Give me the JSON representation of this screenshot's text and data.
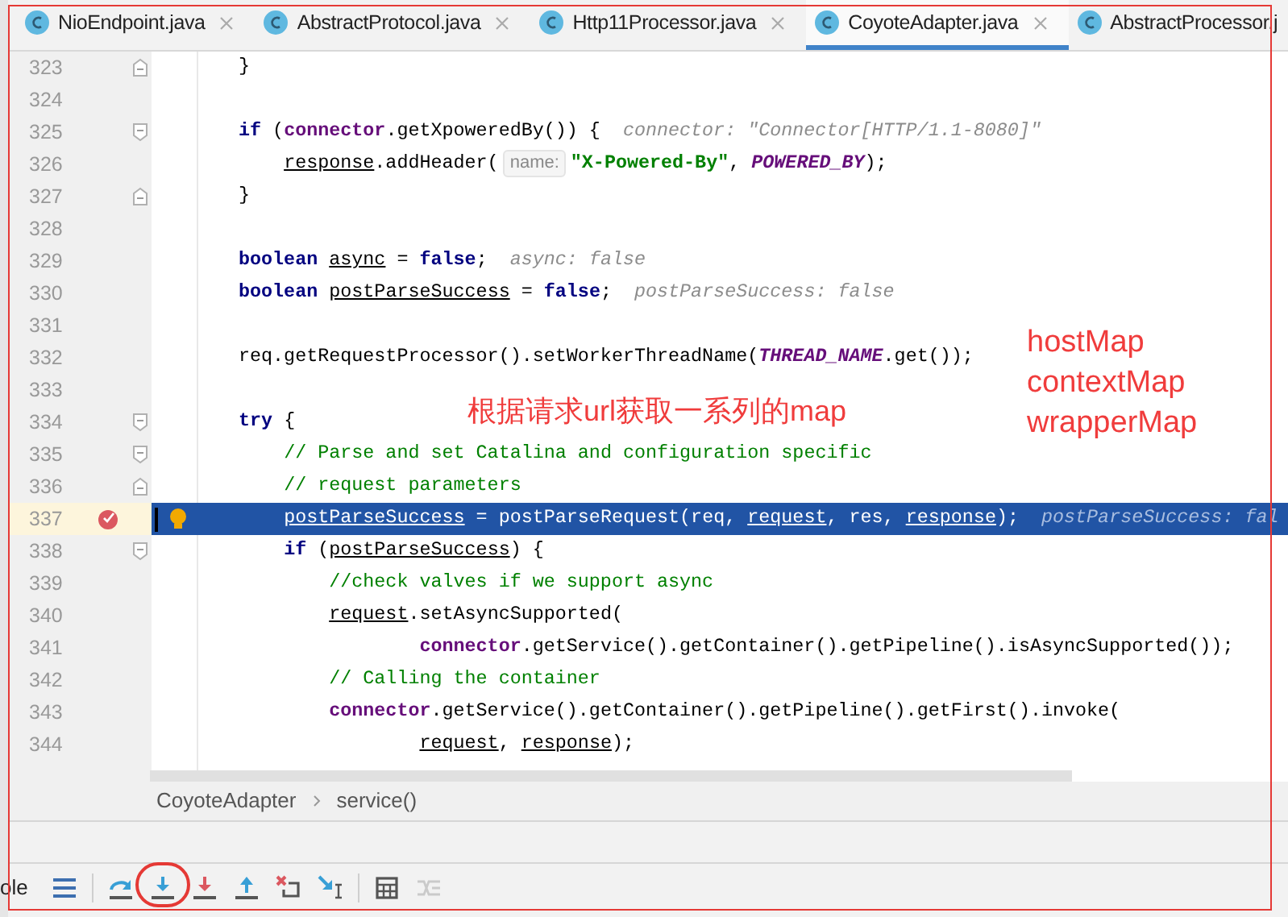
{
  "tabs": [
    {
      "label": "NioEndpoint.java",
      "selected": false,
      "closable": true
    },
    {
      "label": "AbstractProtocol.java",
      "selected": false,
      "closable": true
    },
    {
      "label": "Http11Processor.java",
      "selected": false,
      "closable": true
    },
    {
      "label": "CoyoteAdapter.java",
      "selected": true,
      "closable": true
    },
    {
      "label": "AbstractProcessor.j",
      "selected": false,
      "closable": false
    }
  ],
  "editor": {
    "lines": [
      {
        "number": "323",
        "selected": false,
        "breakpoint": false,
        "fold_start": false,
        "fold_end": true,
        "segments": [
          {
            "kind": "plain",
            "text": "}"
          }
        ]
      },
      {
        "number": "324",
        "selected": false,
        "breakpoint": false,
        "fold_start": false,
        "fold_end": false
      },
      {
        "number": "325",
        "selected": false,
        "breakpoint": false,
        "fold_start": true,
        "fold_end": false,
        "segments": [
          {
            "kind": "keyword",
            "text": "if"
          },
          {
            "kind": "plain",
            "text": " ("
          },
          {
            "kind": "field",
            "text": "connector"
          },
          {
            "kind": "plain",
            "text": ".getXpoweredBy()) {"
          },
          {
            "kind": "hint",
            "text": "connector: \"Connector[HTTP/1.1-8080]\""
          }
        ]
      },
      {
        "number": "326",
        "selected": false,
        "breakpoint": false,
        "fold_start": false,
        "fold_end": false,
        "segments": [
          {
            "kind": "variable",
            "text": "    response"
          },
          {
            "kind": "plain",
            "text": ".addHeader("
          },
          {
            "kind": "param",
            "text": "name:"
          },
          {
            "kind": "string",
            "text": "\"X-Powered-By\""
          },
          {
            "kind": "plain",
            "text": ", "
          },
          {
            "kind": "constant",
            "text": "POWERED_BY"
          },
          {
            "kind": "plain",
            "text": ");"
          }
        ]
      },
      {
        "number": "327",
        "selected": false,
        "breakpoint": false,
        "fold_start": false,
        "fold_end": true,
        "segments": [
          {
            "kind": "plain",
            "text": "}"
          }
        ]
      },
      {
        "number": "328",
        "selected": false,
        "breakpoint": false,
        "fold_start": false,
        "fold_end": false
      },
      {
        "number": "329",
        "selected": false,
        "breakpoint": false,
        "fold_start": false,
        "fold_end": false,
        "segments": [
          {
            "kind": "keyword",
            "text": "boolean"
          },
          {
            "kind": "variable",
            "text": " async"
          },
          {
            "kind": "plain",
            "text": " = "
          },
          {
            "kind": "keyword",
            "text": "false"
          },
          {
            "kind": "plain",
            "text": ";"
          },
          {
            "kind": "hint",
            "text": "async: false"
          }
        ]
      },
      {
        "number": "330",
        "selected": false,
        "breakpoint": false,
        "fold_start": false,
        "fold_end": false,
        "segments": [
          {
            "kind": "keyword",
            "text": "boolean"
          },
          {
            "kind": "variable",
            "text": " postParseSuccess"
          },
          {
            "kind": "plain",
            "text": " = "
          },
          {
            "kind": "keyword",
            "text": "false"
          },
          {
            "kind": "plain",
            "text": ";"
          },
          {
            "kind": "hint",
            "text": "postParseSuccess: false"
          }
        ]
      },
      {
        "number": "331",
        "selected": false,
        "breakpoint": false,
        "fold_start": false,
        "fold_end": false
      },
      {
        "number": "332",
        "selected": false,
        "breakpoint": false,
        "fold_start": false,
        "fold_end": false,
        "segments": [
          {
            "kind": "plain",
            "text": "req.getRequestProcessor().setWorkerThreadName("
          },
          {
            "kind": "constant",
            "text": "THREAD_NAME"
          },
          {
            "kind": "plain",
            "text": ".get());"
          }
        ]
      },
      {
        "number": "333",
        "selected": false,
        "breakpoint": false,
        "fold_start": false,
        "fold_end": false
      },
      {
        "number": "334",
        "selected": false,
        "breakpoint": false,
        "fold_start": true,
        "fold_end": false,
        "segments": [
          {
            "kind": "keyword",
            "text": "try"
          },
          {
            "kind": "plain",
            "text": " {"
          }
        ]
      },
      {
        "number": "335",
        "selected": false,
        "breakpoint": false,
        "fold_start": true,
        "fold_end": false,
        "segments": [
          {
            "kind": "comment",
            "text": "    // Parse and set Catalina and configuration specific"
          }
        ]
      },
      {
        "number": "336",
        "selected": false,
        "breakpoint": false,
        "fold_start": false,
        "fold_end": true,
        "segments": [
          {
            "kind": "comment",
            "text": "    // request parameters"
          }
        ]
      },
      {
        "number": "337",
        "selected": true,
        "breakpoint": true,
        "fold_start": false,
        "fold_end": false,
        "segments": [
          {
            "kind": "variable",
            "text": "    postParseSuccess"
          },
          {
            "kind": "plain",
            "text": " = postParseRequest(req, "
          },
          {
            "kind": "variable",
            "text": "request"
          },
          {
            "kind": "plain",
            "text": ", res, "
          },
          {
            "kind": "variable",
            "text": "response"
          },
          {
            "kind": "plain",
            "text": ");"
          },
          {
            "kind": "hint",
            "text": "postParseSuccess: fal"
          }
        ]
      },
      {
        "number": "338",
        "selected": false,
        "breakpoint": false,
        "fold_start": true,
        "fold_end": false,
        "segments": [
          {
            "kind": "keyword",
            "text": "    if"
          },
          {
            "kind": "plain",
            "text": " ("
          },
          {
            "kind": "variable",
            "text": "postParseSuccess"
          },
          {
            "kind": "plain",
            "text": ") {"
          }
        ]
      },
      {
        "number": "339",
        "selected": false,
        "breakpoint": false,
        "fold_start": false,
        "fold_end": false,
        "segments": [
          {
            "kind": "comment",
            "text": "        //check valves if we support async"
          }
        ]
      },
      {
        "number": "340",
        "selected": false,
        "breakpoint": false,
        "fold_start": false,
        "fold_end": false,
        "segments": [
          {
            "kind": "variable",
            "text": "        request"
          },
          {
            "kind": "plain",
            "text": ".setAsyncSupported("
          }
        ]
      },
      {
        "number": "341",
        "selected": false,
        "breakpoint": false,
        "fold_start": false,
        "fold_end": false,
        "segments": [
          {
            "kind": "field",
            "text": "                connector"
          },
          {
            "kind": "plain",
            "text": ".getService().getContainer().getPipeline().isAsyncSupported());"
          }
        ]
      },
      {
        "number": "342",
        "selected": false,
        "breakpoint": false,
        "fold_start": false,
        "fold_end": false,
        "segments": [
          {
            "kind": "comment",
            "text": "        // Calling the container"
          }
        ]
      },
      {
        "number": "343",
        "selected": false,
        "breakpoint": false,
        "fold_start": false,
        "fold_end": false,
        "segments": [
          {
            "kind": "field",
            "text": "        connector"
          },
          {
            "kind": "plain",
            "text": ".getService().getContainer().getPipeline().getFirst().invoke("
          }
        ]
      },
      {
        "number": "344",
        "selected": false,
        "breakpoint": false,
        "fold_start": false,
        "fold_end": false,
        "segments": [
          {
            "kind": "variable",
            "text": "                request"
          },
          {
            "kind": "plain",
            "text": ", "
          },
          {
            "kind": "variable",
            "text": "response"
          },
          {
            "kind": "plain",
            "text": ");"
          }
        ]
      }
    ]
  },
  "annotations": {
    "note": "根据请求url获取一系列的map",
    "maps": [
      "hostMap",
      "contextMap",
      "wrapperMap"
    ]
  },
  "breadcrumbs": [
    "CoyoteAdapter",
    "service()"
  ],
  "debug_toolbar": {
    "label": "ole",
    "buttons": [
      {
        "kind": "lines",
        "disabled": false,
        "circled": false
      },
      {
        "kind": "step-over",
        "disabled": false,
        "circled": false
      },
      {
        "kind": "step-into",
        "disabled": false,
        "circled": true
      },
      {
        "kind": "force-step-into",
        "disabled": false,
        "circled": false
      },
      {
        "kind": "step-out",
        "disabled": false,
        "circled": false
      },
      {
        "kind": "drop-frame",
        "disabled": false,
        "circled": false
      },
      {
        "kind": "run-to-cursor",
        "disabled": false,
        "circled": false
      },
      {
        "kind": "evaluate",
        "disabled": false,
        "circled": false
      },
      {
        "kind": "trace",
        "disabled": true,
        "circled": false
      }
    ]
  }
}
